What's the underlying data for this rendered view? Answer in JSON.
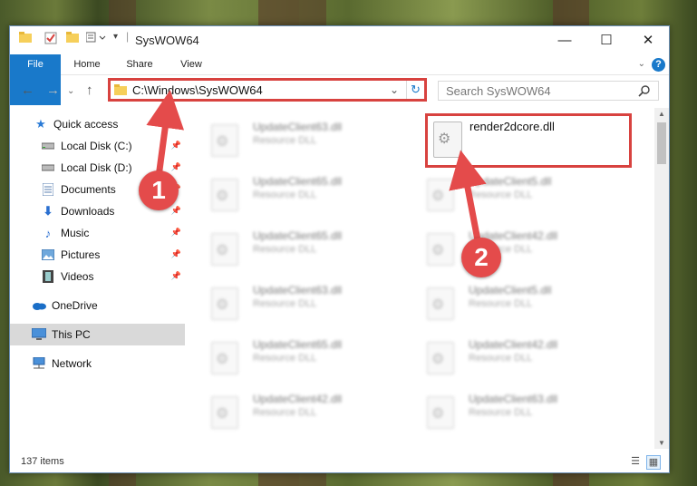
{
  "window": {
    "title": "SysWOW64",
    "controls": {
      "minimize": "—",
      "maximize": "☐",
      "close": "✕"
    }
  },
  "ribbon": {
    "tabs": [
      "File",
      "Home",
      "Share",
      "View"
    ],
    "help": "?"
  },
  "nav": {
    "address": "C:\\Windows\\SysWOW64",
    "search_placeholder": "Search SysWOW64"
  },
  "sidebar": {
    "items": [
      {
        "label": "Quick access",
        "icon": "star-icon"
      },
      {
        "label": "Local Disk (C:)",
        "icon": "drive-icon"
      },
      {
        "label": "Local Disk (D:)",
        "icon": "drive-icon"
      },
      {
        "label": "Documents",
        "icon": "documents-icon"
      },
      {
        "label": "Downloads",
        "icon": "download-icon"
      },
      {
        "label": "Music",
        "icon": "music-icon"
      },
      {
        "label": "Pictures",
        "icon": "pictures-icon"
      },
      {
        "label": "Videos",
        "icon": "videos-icon"
      },
      {
        "label": "OneDrive",
        "icon": "cloud-icon"
      },
      {
        "label": "This PC",
        "icon": "computer-icon"
      },
      {
        "label": "Network",
        "icon": "network-icon"
      }
    ]
  },
  "files": {
    "left": [
      {
        "name": "UpdateClient63.dll",
        "type": "Resource DLL"
      },
      {
        "name": "UpdateClient65.dll",
        "type": "Resource DLL"
      },
      {
        "name": "UpdateClient65.dll",
        "type": "Resource DLL"
      },
      {
        "name": "UpdateClient63.dll",
        "type": "Resource DLL"
      },
      {
        "name": "UpdateClient65.dll",
        "type": "Resource DLL"
      },
      {
        "name": "UpdateClient42.dll",
        "type": "Resource DLL"
      }
    ],
    "right": [
      {
        "name": "render2dcore.dll",
        "type": ""
      },
      {
        "name": "UpdateClient5.dll",
        "type": "Resource DLL"
      },
      {
        "name": "UpdateClient42.dll",
        "type": "Resource DLL"
      },
      {
        "name": "UpdateClient5.dll",
        "type": "Resource DLL"
      },
      {
        "name": "UpdateClient42.dll",
        "type": "Resource DLL"
      },
      {
        "name": "UpdateClient63.dll",
        "type": "Resource DLL"
      }
    ]
  },
  "status": {
    "count": "137 items"
  },
  "callouts": [
    "1",
    "2"
  ],
  "colors": {
    "accent": "#1979ca",
    "highlight": "#d8423f",
    "callout": "#e44b4b"
  }
}
